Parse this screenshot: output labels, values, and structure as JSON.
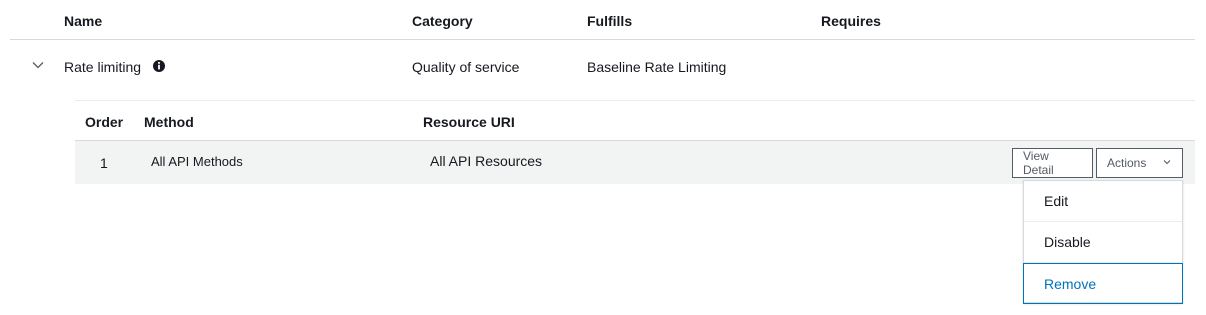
{
  "table": {
    "headers": {
      "name": "Name",
      "category": "Category",
      "fulfills": "Fulfills",
      "requires": "Requires"
    },
    "row": {
      "name": "Rate limiting",
      "category": "Quality of service",
      "fulfills": "Baseline Rate Limiting",
      "requires": ""
    }
  },
  "subtable": {
    "headers": {
      "order": "Order",
      "method": "Method",
      "resource_uri": "Resource URI"
    },
    "row": {
      "order": "1",
      "method": "All API Methods",
      "resource_uri": "All API Resources",
      "view_detail_label": "View Detail",
      "actions_label": "Actions"
    }
  },
  "actions_menu": {
    "items": [
      {
        "label": "Edit"
      },
      {
        "label": "Disable"
      },
      {
        "label": "Remove",
        "active": true
      }
    ]
  },
  "colors": {
    "link_blue": "#0073bb",
    "row_gray": "#f2f3f3",
    "border": "#d5dbdb"
  },
  "icons": {
    "expand": "chevron-down-icon",
    "info": "info-icon",
    "dropdown": "chevron-down-icon"
  }
}
